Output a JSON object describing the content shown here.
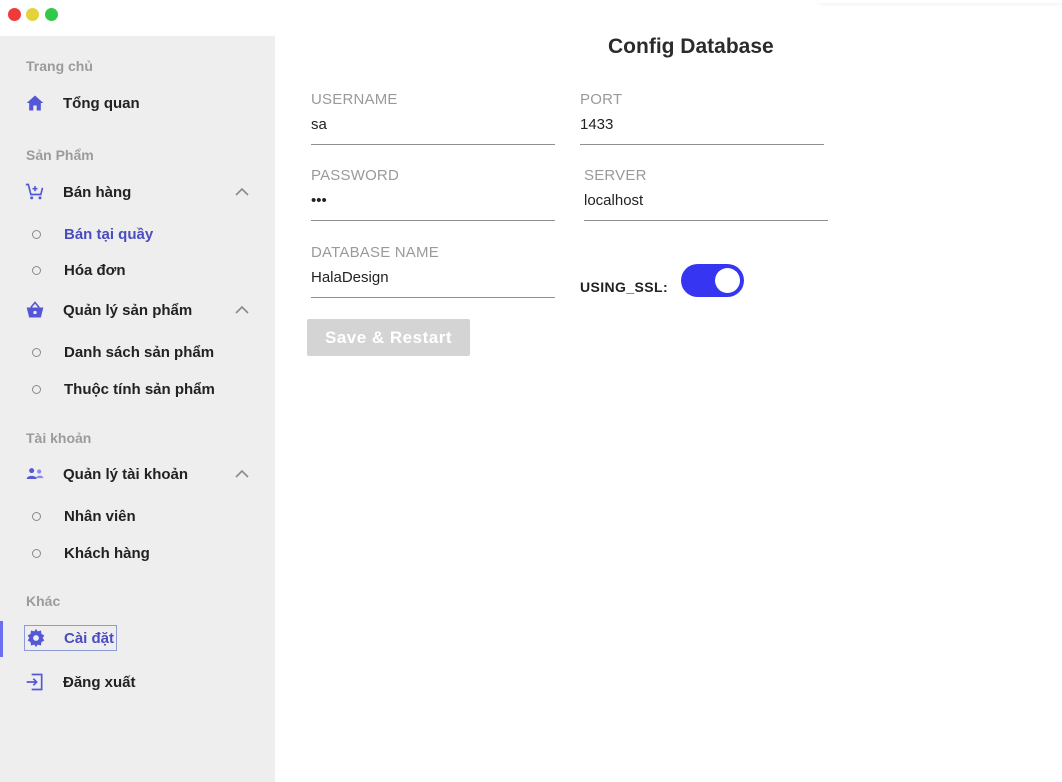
{
  "window": {
    "controls": [
      "close",
      "minimize",
      "maximize"
    ],
    "colors": {
      "close": "#ee3a3a",
      "minimize": "#e3d239",
      "maximize": "#32c94a"
    }
  },
  "sidebar": {
    "sections": [
      {
        "title": "Trang chủ"
      },
      {
        "title": "Sản Phẩm"
      },
      {
        "title": "Tài khoản"
      },
      {
        "title": "Khác"
      }
    ],
    "items": {
      "overview": {
        "label": "Tổng quan",
        "icon": "home-icon"
      },
      "sales": {
        "label": "Bán hàng",
        "icon": "cart-icon",
        "expanded": true,
        "children": [
          {
            "label": "Bán tại quầy",
            "active": true
          },
          {
            "label": "Hóa đơn"
          }
        ]
      },
      "products": {
        "label": "Quản lý sản phẩm",
        "icon": "basket-icon",
        "expanded": true,
        "children": [
          {
            "label": "Danh sách sản phẩm"
          },
          {
            "label": "Thuộc tính sản phẩm"
          }
        ]
      },
      "accounts": {
        "label": "Quản lý tài khoản",
        "icon": "users-icon",
        "expanded": true,
        "children": [
          {
            "label": "Nhân viên"
          },
          {
            "label": "Khách hàng"
          }
        ]
      },
      "settings": {
        "label": "Cài đặt",
        "icon": "gear-icon",
        "active": true
      },
      "logout": {
        "label": "Đăng xuất",
        "icon": "logout-icon"
      }
    },
    "accent_color": "#4a4dbf"
  },
  "main": {
    "title": "Config Database",
    "fields": {
      "username": {
        "label": "USERNAME",
        "value": "sa"
      },
      "port": {
        "label": "PORT",
        "value": "1433"
      },
      "password": {
        "label": "PASSWORD",
        "value": "•••"
      },
      "server": {
        "label": "SERVER",
        "value": "localhost"
      },
      "database": {
        "label": "DATABASE NAME",
        "value": "HalaDesign"
      }
    },
    "ssl": {
      "label": "USING_SSL:",
      "enabled": true,
      "color": "#3535f2"
    },
    "save_button": {
      "label": "Save & Restart",
      "enabled": false
    }
  }
}
